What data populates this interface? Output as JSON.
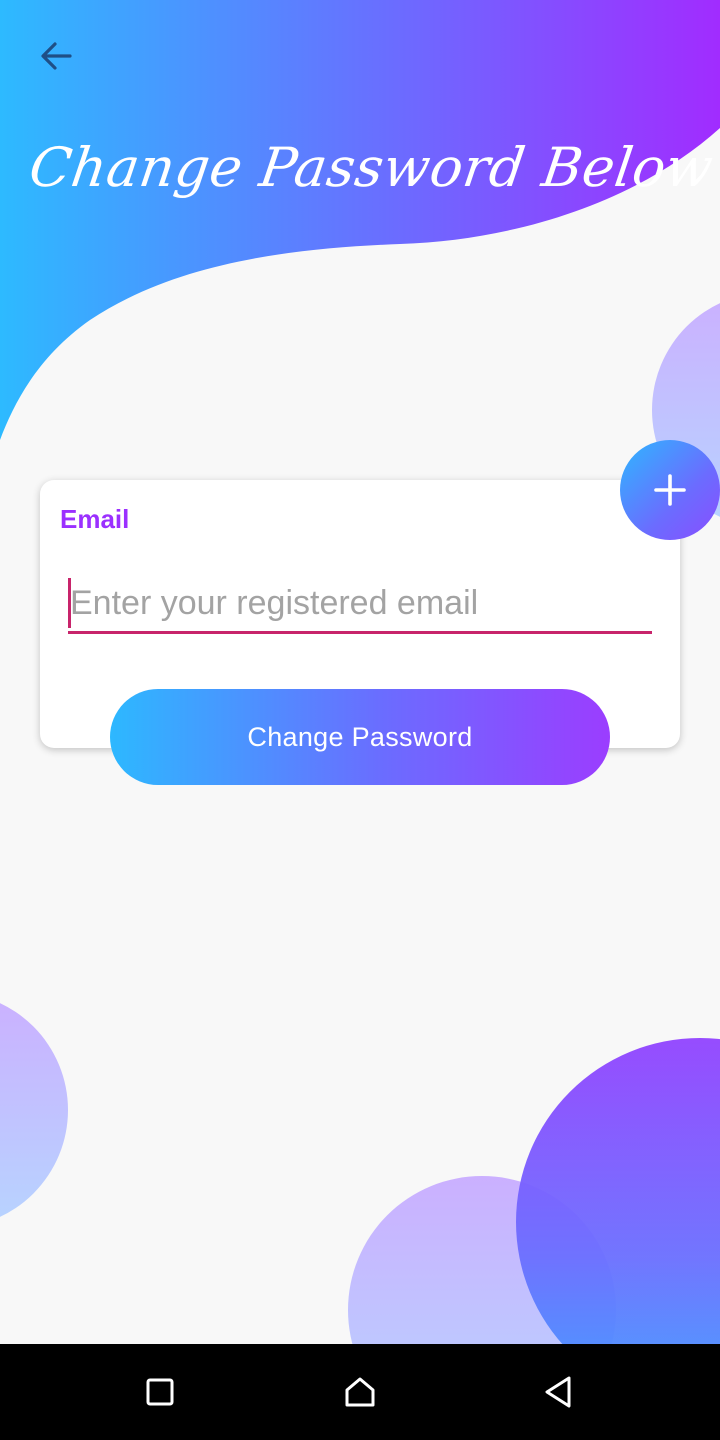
{
  "header": {
    "title": "Change Password Below",
    "back_icon": "arrow-left-icon"
  },
  "form": {
    "email_label": "Email",
    "email_placeholder": "Enter your registered email",
    "email_value": "",
    "submit_label": "Change Password"
  },
  "fab": {
    "icon": "plus-icon"
  },
  "system_nav": {
    "recents_icon": "square-icon",
    "home_icon": "home-icon",
    "back_icon": "triangle-back-icon"
  },
  "colors": {
    "gradient_start": "#2db8ff",
    "gradient_mid": "#6b6cff",
    "gradient_end": "#9b3dff",
    "label_purple": "#9b30ff",
    "input_underline": "#c8246b",
    "background": "#f8f8f8"
  }
}
